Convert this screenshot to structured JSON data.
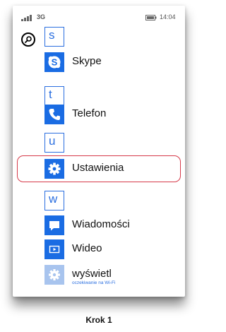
{
  "status_bar": {
    "network": "3G",
    "time": "14:04"
  },
  "search": {
    "icon": "search-icon"
  },
  "app_list": {
    "letters": [
      "s",
      "t",
      "u",
      "w"
    ],
    "apps": [
      {
        "label": "Skype",
        "icon": "skype-icon"
      },
      {
        "label": "Telefon",
        "icon": "phone-icon"
      },
      {
        "label": "Ustawienia",
        "icon": "gear-icon"
      },
      {
        "label": "Wiadomości",
        "icon": "message-icon"
      },
      {
        "label": "Wideo",
        "icon": "video-icon"
      },
      {
        "label": "wyświetl",
        "subtitle": "oczekiwanie na Wi-Fi",
        "icon": "gear-icon"
      }
    ]
  },
  "highlight": {
    "color": "#d63a4a"
  },
  "accent": "#1a6ce3",
  "caption": "Krok 1"
}
